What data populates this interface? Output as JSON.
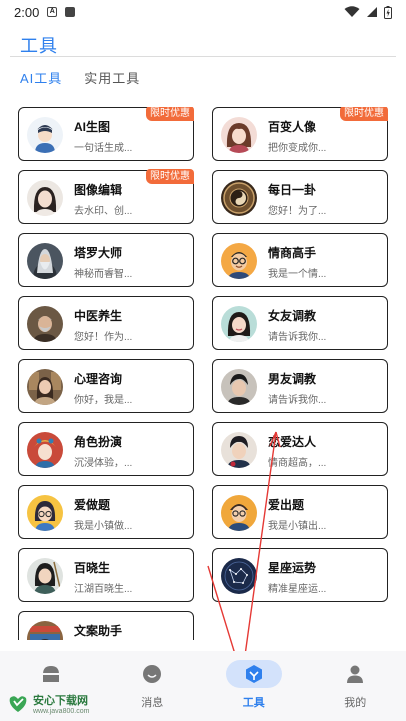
{
  "status_bar": {
    "time": "2:00"
  },
  "header": {
    "title": "工具"
  },
  "tabs": [
    {
      "label": "AI工具",
      "active": true
    },
    {
      "label": "实用工具",
      "active": false
    }
  ],
  "tools": [
    {
      "name": "AI生图",
      "desc": "一句话生成...",
      "badge": "限时优惠",
      "avatar": "boy-cartoon-icon"
    },
    {
      "name": "百变人像",
      "desc": "把你变成你...",
      "badge": "限时优惠",
      "avatar": "girl-portrait-icon"
    },
    {
      "name": "图像编辑",
      "desc": "去水印、创...",
      "badge": "限时优惠",
      "avatar": "woman-portrait-icon"
    },
    {
      "name": "每日一卦",
      "desc": "您好！为了...",
      "badge": "",
      "avatar": "bagua-icon"
    },
    {
      "name": "塔罗大师",
      "desc": "神秘而睿智...",
      "badge": "",
      "avatar": "sorcerer-icon"
    },
    {
      "name": "情商高手",
      "desc": "我是一个情...",
      "badge": "",
      "avatar": "glasses-man-icon"
    },
    {
      "name": "中医养生",
      "desc": "您好！作为...",
      "badge": "",
      "avatar": "old-doctor-icon"
    },
    {
      "name": "女友调教",
      "desc": "请告诉我你...",
      "badge": "",
      "avatar": "girlfriend-icon"
    },
    {
      "name": "心理咨询",
      "desc": "你好，我是...",
      "badge": "",
      "avatar": "counselor-icon"
    },
    {
      "name": "男友调教",
      "desc": "请告诉我你...",
      "badge": "",
      "avatar": "boyfriend-icon"
    },
    {
      "name": "角色扮演",
      "desc": "沉浸体验，...",
      "badge": "",
      "avatar": "opera-icon"
    },
    {
      "name": "恋爱达人",
      "desc": "情商超高，...",
      "badge": "",
      "avatar": "romance-man-icon"
    },
    {
      "name": "爱做题",
      "desc": "我是小镇做...",
      "badge": "",
      "avatar": "student-girl-icon"
    },
    {
      "name": "爱出题",
      "desc": "我是小镇出...",
      "badge": "",
      "avatar": "teacher-icon"
    },
    {
      "name": "百晓生",
      "desc": "江湖百晓生...",
      "badge": "",
      "avatar": "swordsman-icon"
    },
    {
      "name": "星座运势",
      "desc": "精准星座运...",
      "badge": "",
      "avatar": "constellation-icon"
    },
    {
      "name": "文案助手",
      "desc": "",
      "badge": "",
      "avatar": "writer-icon"
    }
  ],
  "bottom_nav": [
    {
      "label": "",
      "icon": "home-icon",
      "active": false
    },
    {
      "label": "消息",
      "icon": "message-icon",
      "active": false
    },
    {
      "label": "工具",
      "icon": "tools-cube-icon",
      "active": true
    },
    {
      "label": "我的",
      "icon": "profile-icon",
      "active": false
    }
  ],
  "watermark": {
    "line1": "安心下载网",
    "line2": "www.java800.com"
  },
  "colors": {
    "accent": "#2f80ed",
    "badge": "#f26b3a",
    "annotation_arrow": "#e53935"
  }
}
